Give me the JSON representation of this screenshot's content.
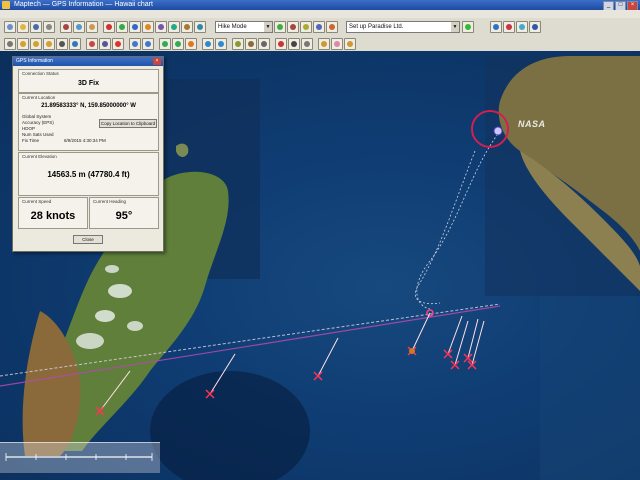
{
  "window": {
    "title": "Maptech — GPS Information — Hawaii chart"
  },
  "toolbar": {
    "chart_combo": "Hike Mode",
    "location_combo": "Set up Paradise Ltd."
  },
  "gps_dialog": {
    "title": "GPS Information",
    "connection_status_label": "Connection Status",
    "connection_status": "3D Fix",
    "current_location_label": "Current Location",
    "current_location": "21.89583333° N, 159.85000000° W",
    "details": [
      "Global System",
      "Accuracy (EPS)",
      "HDOP",
      "Num Sats Used",
      "Fix Time"
    ],
    "copy_button": "Copy Location to Clipboard",
    "fix_time": "8/9/2015 4:30:34 PM",
    "current_elevation_label": "Current Elevation",
    "current_elevation": "14563.5 m (47780.4 ft)",
    "current_speed_label": "Current Speed",
    "current_speed": "28 knots",
    "current_heading_label": "Current Heading",
    "current_heading": "95°",
    "close_button": "Close"
  },
  "map": {
    "watermark": "NASA"
  }
}
